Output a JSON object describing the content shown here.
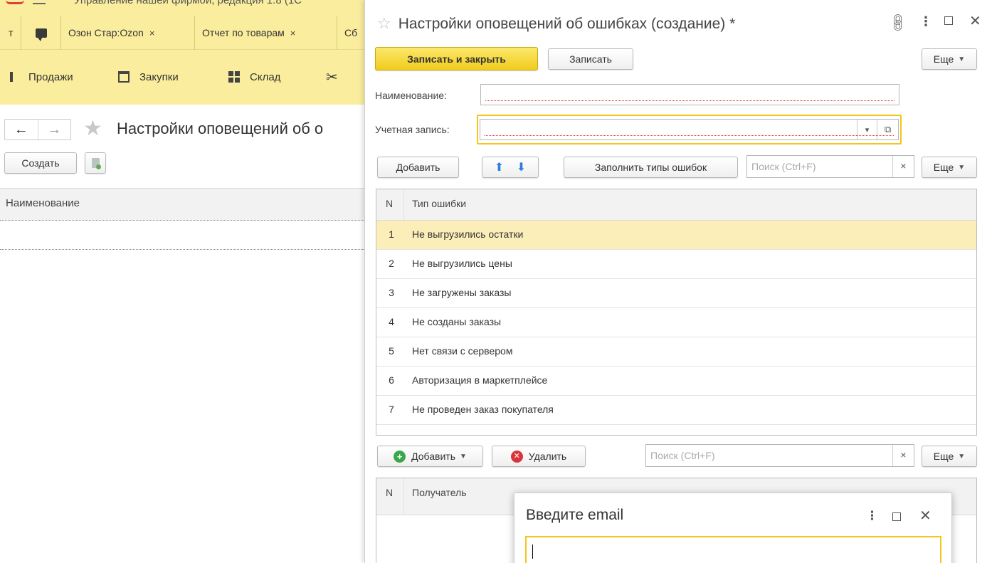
{
  "background_window": {
    "app_title": "Управление нашей фирмой, редакция 1.8 (1С",
    "tabs": [
      {
        "label": "Озон Стар:Ozon"
      },
      {
        "label": "Отчет по товарам"
      },
      {
        "label": "Сб"
      }
    ],
    "tab_first_fragment": "т",
    "close_glyph": "×",
    "sections": [
      {
        "label": "Продажи",
        "icon": "cart-icon"
      },
      {
        "label": "Закупки",
        "icon": "purchase-icon"
      },
      {
        "label": "Склад",
        "icon": "warehouse-icon"
      }
    ],
    "page_title": "Настройки оповещений об о",
    "create_button": "Создать",
    "list_column": "Наименование"
  },
  "form": {
    "title": "Настройки оповещений об ошибках (создание) *",
    "save_close_button": "Записать и закрыть",
    "save_button": "Записать",
    "more_button": "Еще",
    "name_label": "Наименование:",
    "name_value": "",
    "account_label": "Учетная запись:",
    "account_value": "",
    "error_types_toolbar": {
      "add_button": "Добавить",
      "fill_button": "Заполнить типы ошибок",
      "search_placeholder": "Поиск (Ctrl+F)",
      "more_button": "Еще"
    },
    "error_types_table": {
      "columns": [
        "N",
        "Тип ошибки"
      ],
      "rows": [
        {
          "n": "1",
          "type": "Не выгрузились остатки"
        },
        {
          "n": "2",
          "type": "Не выгрузились цены"
        },
        {
          "n": "3",
          "type": "Не загружены заказы"
        },
        {
          "n": "4",
          "type": "Не созданы заказы"
        },
        {
          "n": "5",
          "type": "Нет связи с сервером"
        },
        {
          "n": "6",
          "type": "Авторизация в маркетплейсе"
        },
        {
          "n": "7",
          "type": "Не проведен заказ покупателя"
        }
      ],
      "selected_row": 1
    },
    "recipients_toolbar": {
      "add_button": "Добавить",
      "delete_button": "Удалить",
      "search_placeholder": "Поиск (Ctrl+F)",
      "more_button": "Еще"
    },
    "recipients_table": {
      "columns": [
        "N",
        "Получатель"
      ]
    }
  },
  "email_dialog": {
    "title": "Введите email",
    "value": ""
  },
  "colors": {
    "accent_yellow": "#f2cc1c",
    "panel_yellow": "#fbed9e",
    "selected_row": "#fbeeb9",
    "add_green": "#3aa84a",
    "delete_red": "#d8343a",
    "arrow_blue": "#2f7fd6"
  }
}
